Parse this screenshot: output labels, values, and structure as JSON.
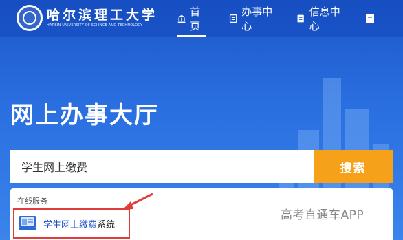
{
  "header": {
    "logo_cn": "哈尔滨理工大学",
    "logo_en": "HARBIN UNIVERSITY OF SCIENCE AND TECHNOLOGY"
  },
  "nav": {
    "items": [
      {
        "label": "首页",
        "icon": "home-icon",
        "active": true
      },
      {
        "label": "办事中心",
        "icon": "document-icon",
        "active": false
      },
      {
        "label": "信息中心",
        "icon": "document-icon",
        "active": false
      }
    ]
  },
  "hero": {
    "title": "网上办事大厅"
  },
  "search": {
    "value": "学生网上缴费",
    "button_label": "搜索"
  },
  "results": {
    "section_label": "在线服务",
    "items": [
      {
        "highlight": "学生网上缴费",
        "rest": "系统",
        "icon": "monitor-icon"
      }
    ]
  },
  "watermark": "高考直通车APP",
  "colors": {
    "accent": "#f5a119",
    "brand_blue": "#1d57c9",
    "highlight_border": "#e03c3c"
  }
}
